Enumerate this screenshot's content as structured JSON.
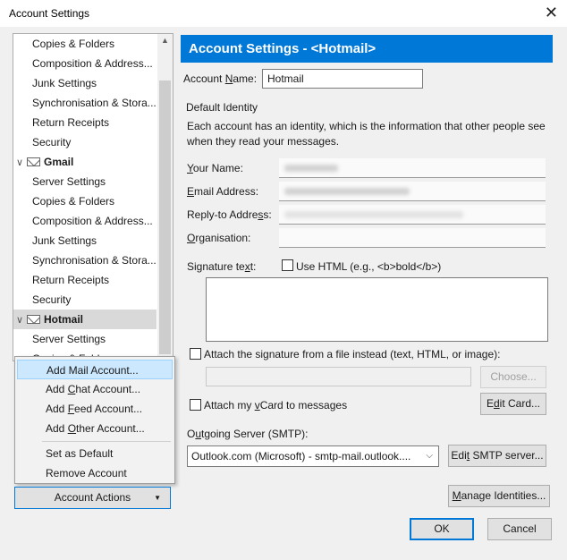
{
  "window": {
    "title": "Account Settings",
    "close_glyph": "✕"
  },
  "tree": {
    "items": [
      {
        "label": "Copies & Folders",
        "type": "child"
      },
      {
        "label": "Composition & Address...",
        "type": "child"
      },
      {
        "label": "Junk Settings",
        "type": "child"
      },
      {
        "label": "Synchronisation & Stora...",
        "type": "child"
      },
      {
        "label": "Return Receipts",
        "type": "child"
      },
      {
        "label": "Security",
        "type": "child"
      },
      {
        "label": "Gmail",
        "type": "account"
      },
      {
        "label": "Server Settings",
        "type": "child"
      },
      {
        "label": "Copies & Folders",
        "type": "child"
      },
      {
        "label": "Composition & Address...",
        "type": "child"
      },
      {
        "label": "Junk Settings",
        "type": "child"
      },
      {
        "label": "Synchronisation & Stora...",
        "type": "child"
      },
      {
        "label": "Return Receipts",
        "type": "child"
      },
      {
        "label": "Security",
        "type": "child"
      },
      {
        "label": "Hotmail",
        "type": "account",
        "selected": true
      },
      {
        "label": "Server Settings",
        "type": "child"
      },
      {
        "label": "Copies & Folders",
        "type": "child"
      }
    ]
  },
  "menu": {
    "items": [
      {
        "label": "Add Mail Account...",
        "highlighted": true
      },
      {
        "label": "Add Chat Account..."
      },
      {
        "label": "Add Feed Account..."
      },
      {
        "label": "Add Other Account..."
      },
      {
        "label": "Set as Default"
      },
      {
        "label": "Remove Account"
      }
    ]
  },
  "account_actions": {
    "label": "Account Actions",
    "caret": "▼"
  },
  "panel": {
    "header": "Account Settings - <Hotmail>",
    "account_name_label": "Account Name:",
    "account_name_value": "Hotmail",
    "default_identity": "Default Identity",
    "identity_desc_1": "Each account has an identity, which is the information that other people see",
    "identity_desc_2": "when they read your messages.",
    "your_name_label": "Your Name:",
    "email_label": "Email Address:",
    "reply_to_label": "Reply-to Address:",
    "organisation_label": "Organisation:",
    "signature_label": "Signature text:",
    "use_html_label": "Use HTML (e.g., <b>bold</b>)",
    "attach_sig_label": "Attach the signature from a file instead (text, HTML, or image):",
    "choose_label": "Choose...",
    "attach_vcard_label": "Attach my vCard to messages",
    "edit_card_label": "Edit Card...",
    "outgoing_label": "Outgoing Server (SMTP):",
    "smtp_value": "Outlook.com (Microsoft) - smtp-mail.outlook....",
    "edit_smtp_label": "Edit SMTP server...",
    "manage_identities_label": "Manage Identities...",
    "ok_label": "OK",
    "cancel_label": "Cancel"
  },
  "colors": {
    "accent": "#0078d7",
    "menu_highlight": "#cce8ff"
  }
}
